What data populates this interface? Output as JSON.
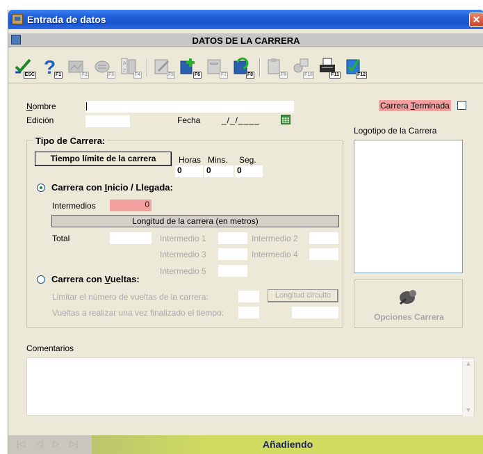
{
  "window": {
    "title": "Entrada de datos",
    "close": "✕"
  },
  "header": {
    "title": "DATOS DE LA CARRERA"
  },
  "toolbar": {
    "items": [
      {
        "name": "esc",
        "key": "ESC"
      },
      {
        "name": "help",
        "key": "F1"
      },
      {
        "name": "f2",
        "key": "F2"
      },
      {
        "name": "f3",
        "key": "F3"
      },
      {
        "name": "f4",
        "key": "F4"
      },
      {
        "name": "f5",
        "key": "F5"
      },
      {
        "name": "f6",
        "key": "F6"
      },
      {
        "name": "f7",
        "key": "F7"
      },
      {
        "name": "f8",
        "key": "F8"
      },
      {
        "name": "f9",
        "key": "F9"
      },
      {
        "name": "f10",
        "key": "F10"
      },
      {
        "name": "f11",
        "key": "F11"
      },
      {
        "name": "f12",
        "key": "F12"
      }
    ]
  },
  "form": {
    "nombre_label": "Nombre",
    "nombre_value": "",
    "edicion_label": "Edición",
    "edicion_value": "",
    "fecha_label": "Fecha",
    "fecha_value": "_/_/____",
    "terminada_label": "Carrera Terminada",
    "logo_label": "Logotipo de la Carrera"
  },
  "tipo": {
    "title": "Tipo de Carrera:",
    "tiempo_button": "Tiempo límite de la carrera",
    "horas_label": "Horas",
    "mins_label": "Mins.",
    "seg_label": "Seg.",
    "horas_value": "0",
    "mins_value": "0",
    "seg_value": "0",
    "inicio_radio": "Carrera con Inicio / Llegada:",
    "intermedios_label": "Intermedios",
    "intermedios_value": "0",
    "longitud_band": "Longitud de la carrera (en metros)",
    "total_label": "Total",
    "intermedio1": "Intermedio 1",
    "intermedio2": "Intermedio 2",
    "intermedio3": "Intermedio 3",
    "intermedio4": "Intermedio 4",
    "intermedio5": "Intermedio 5",
    "vueltas_radio": "Carrera con Vueltas:",
    "limitar_label": "Limitar el número de vueltas de la carrera:",
    "longitud_circuito": "Longitud circuito",
    "vueltas_realizar_label": "Vueltas a realizar una vez finalizado el tiempo:"
  },
  "opciones_button": "Opciones Carrera",
  "comentarios_label": "Comentarios",
  "status": {
    "text": "Añadiendo",
    "nav": [
      "|◁",
      "◁",
      "▷",
      "▷|"
    ]
  }
}
